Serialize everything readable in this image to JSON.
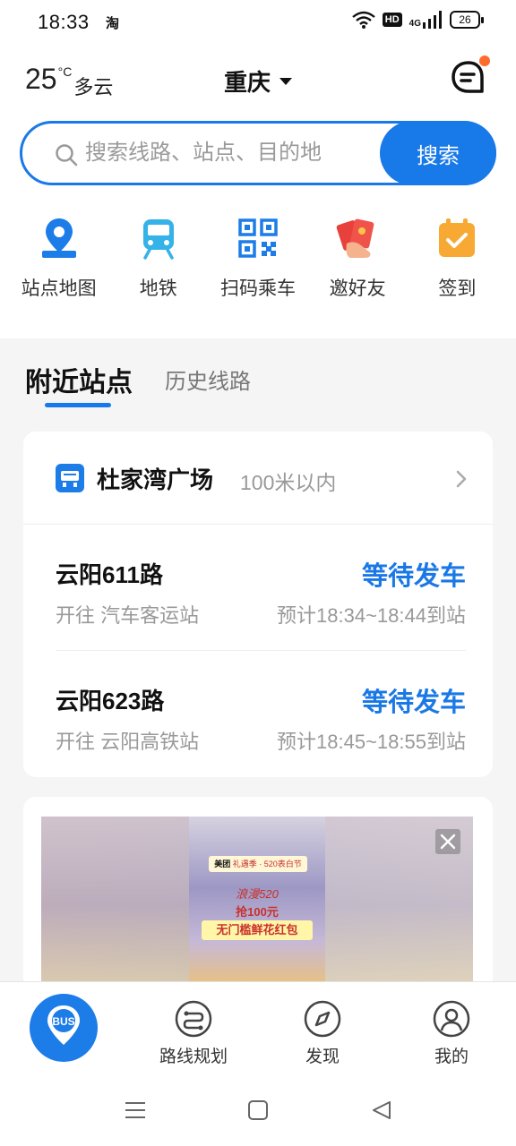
{
  "status_bar": {
    "time": "18:33",
    "app_badge": "淘",
    "hd": "HD",
    "network": "4G",
    "battery": "26"
  },
  "header": {
    "temperature": "25",
    "temperature_unit": "°C",
    "condition": "多云",
    "city": "重庆",
    "message_icon": "chat-bubble-icon",
    "notification_dot_color": "#ff6b2c"
  },
  "search": {
    "placeholder": "搜索线路、站点、目的地",
    "button_label": "搜索"
  },
  "quick_actions": [
    {
      "label": "站点地图",
      "icon": "map-pin-icon"
    },
    {
      "label": "地铁",
      "icon": "metro-train-icon"
    },
    {
      "label": "扫码乘车",
      "icon": "qr-code-icon"
    },
    {
      "label": "邀好友",
      "icon": "red-envelope-icon"
    },
    {
      "label": "签到",
      "icon": "calendar-check-icon"
    }
  ],
  "tabs": {
    "active": "附近站点",
    "inactive": "历史线路"
  },
  "station": {
    "name": "杜家湾广场",
    "distance": "100米以内",
    "routes": [
      {
        "name": "云阳611路",
        "destination": "开往 汽车客运站",
        "status": "等待发车",
        "eta": "预计18:34~18:44到站"
      },
      {
        "name": "云阳623路",
        "destination": "开往 云阳高铁站",
        "status": "等待发车",
        "eta": "预计18:45~18:55到站"
      }
    ]
  },
  "ad": {
    "brand": "美团",
    "tagline": "礼遇季 · 520表白节",
    "line1": "浪漫520",
    "line2": "抢100元",
    "line3": "无门槛鲜花红包"
  },
  "bottom_nav": {
    "bus_label": "BUS",
    "items": [
      {
        "label": "路线规划",
        "icon": "route-plan-icon"
      },
      {
        "label": "发现",
        "icon": "compass-icon"
      },
      {
        "label": "我的",
        "icon": "user-profile-icon"
      }
    ]
  },
  "colors": {
    "accent": "#1879e8",
    "status_blue": "#1a78e6",
    "background": "#f5f5f5"
  }
}
